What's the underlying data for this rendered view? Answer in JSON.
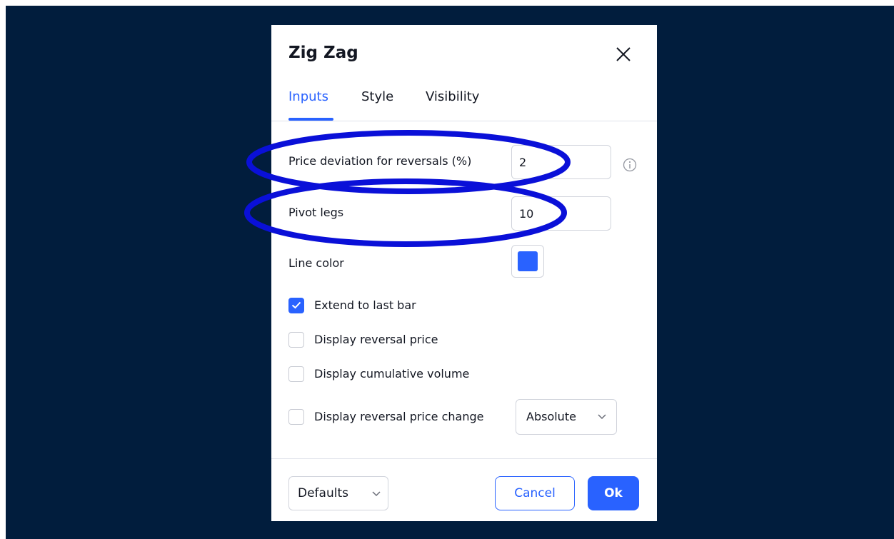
{
  "dialog": {
    "title": "Zig Zag",
    "tabs": [
      {
        "label": "Inputs",
        "active": true
      },
      {
        "label": "Style",
        "active": false
      },
      {
        "label": "Visibility",
        "active": false
      }
    ]
  },
  "inputs": {
    "price_deviation": {
      "label": "Price deviation for reversals (%)",
      "value": "2"
    },
    "pivot_legs": {
      "label": "Pivot legs",
      "value": "10"
    },
    "line_color": {
      "label": "Line color",
      "color": "#2962ff"
    },
    "extend_last_bar": {
      "label": "Extend to last bar",
      "checked": true
    },
    "display_reversal_price": {
      "label": "Display reversal price",
      "checked": false
    },
    "display_cumulative_volume": {
      "label": "Display cumulative volume",
      "checked": false
    },
    "display_reversal_price_change": {
      "label": "Display reversal price change",
      "checked": false
    },
    "price_change_mode": {
      "selected": "Absolute"
    }
  },
  "footer": {
    "defaults_label": "Defaults",
    "cancel_label": "Cancel",
    "ok_label": "Ok"
  },
  "colors": {
    "backdrop": "#011d3d",
    "accent": "#2962ff",
    "annotation": "#0a10d8"
  },
  "icons": [
    "close-icon",
    "info-icon",
    "check-icon",
    "chevron-down-icon"
  ]
}
